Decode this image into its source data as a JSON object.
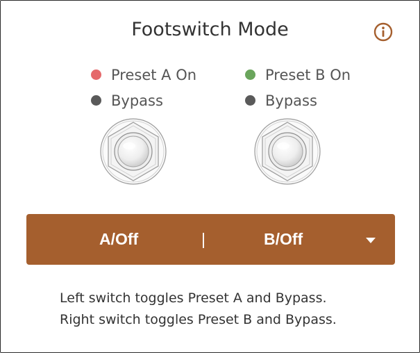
{
  "title": "Footswitch Mode",
  "icons": {
    "info": "info-circle-icon"
  },
  "colors": {
    "accent": "#a55f2e",
    "preset_a_dot": "#e5696b",
    "preset_b_dot": "#6aa55c",
    "bypass_dot": "#5a5a5a"
  },
  "switch_a": {
    "on_label": "Preset A On",
    "bypass_label": "Bypass"
  },
  "switch_b": {
    "on_label": "Preset B On",
    "bypass_label": "Bypass"
  },
  "mode": {
    "left": "A/Off",
    "separator": "|",
    "right": "B/Off"
  },
  "description": {
    "line1": "Left switch toggles Preset A and Bypass.",
    "line2": "Right switch toggles Preset B and Bypass."
  }
}
